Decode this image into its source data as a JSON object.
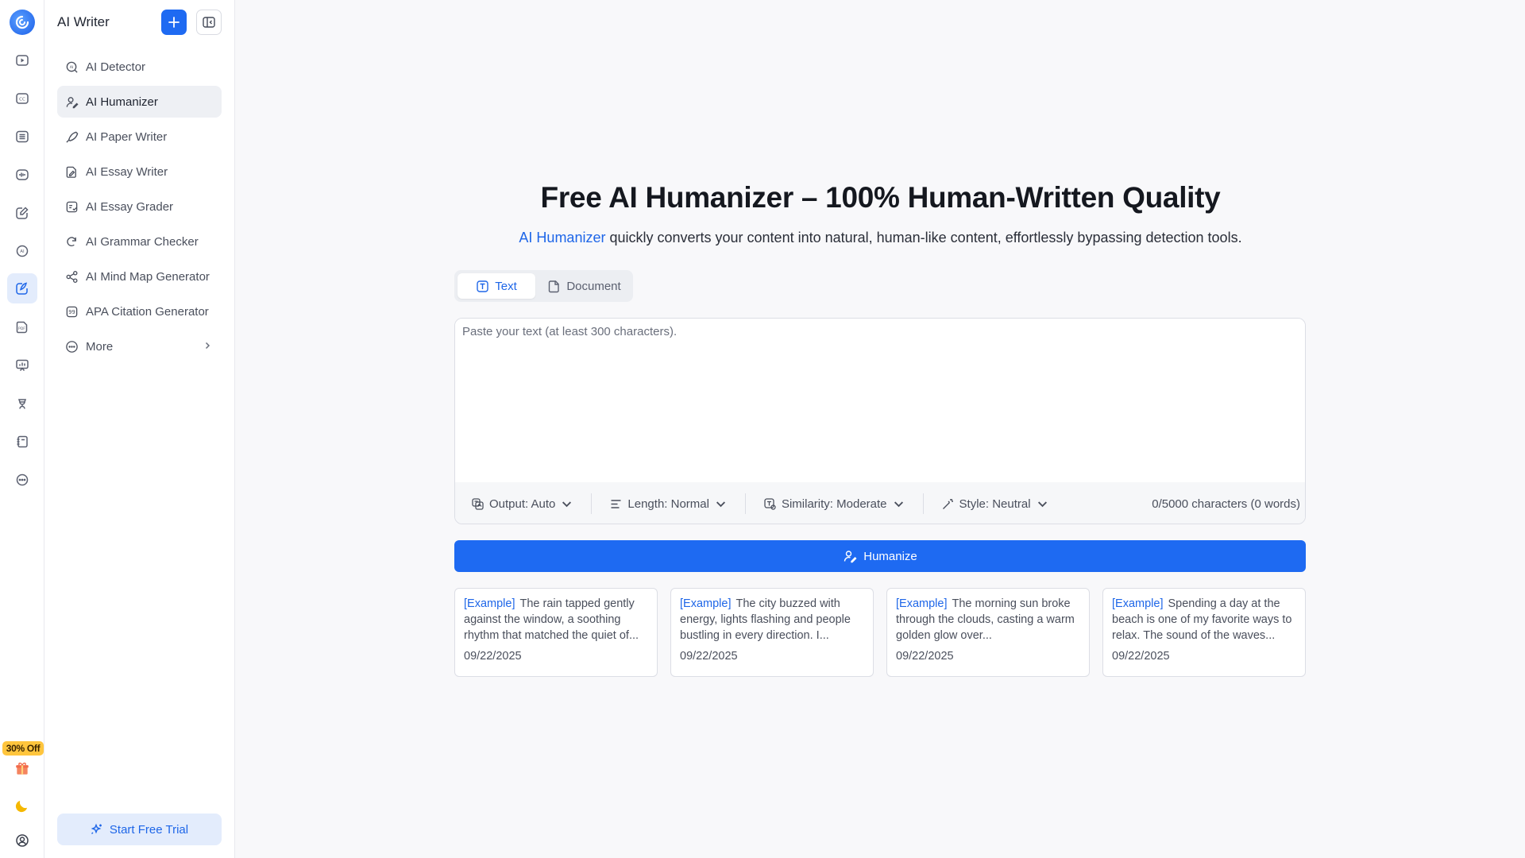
{
  "rail": {
    "promo_badge": "30% Off",
    "items": [
      {
        "name": "video-icon"
      },
      {
        "name": "captions-icon"
      },
      {
        "name": "list-icon"
      },
      {
        "name": "audio-icon"
      },
      {
        "name": "edit-image-icon"
      },
      {
        "name": "ai-detector-icon"
      },
      {
        "name": "ai-writer-icon",
        "active": true
      },
      {
        "name": "pdf-icon"
      },
      {
        "name": "presentation-icon"
      },
      {
        "name": "graduation-icon"
      },
      {
        "name": "notebook-icon"
      },
      {
        "name": "more-icon"
      }
    ]
  },
  "sidebar": {
    "title": "AI Writer",
    "items": [
      {
        "label": "AI Detector",
        "icon": "ai-detector-icon"
      },
      {
        "label": "AI Humanizer",
        "icon": "user-pen-icon",
        "active": true
      },
      {
        "label": "AI Paper Writer",
        "icon": "pen-icon"
      },
      {
        "label": "AI Essay Writer",
        "icon": "essay-icon"
      },
      {
        "label": "AI Essay Grader",
        "icon": "grader-icon"
      },
      {
        "label": "AI Grammar Checker",
        "icon": "grammar-icon"
      },
      {
        "label": "AI Mind Map Generator",
        "icon": "mind-map-icon"
      },
      {
        "label": "APA Citation Generator",
        "icon": "citation-icon"
      },
      {
        "label": "More",
        "icon": "more-dots-icon"
      }
    ],
    "trial_label": "Start Free Trial"
  },
  "main": {
    "headline": "Free AI Humanizer – 100% Human-Written Quality",
    "subhead_link": "AI Humanizer",
    "subhead_rest": " quickly converts your content into natural, human-like content, effortlessly bypassing detection tools.",
    "tabs": [
      {
        "label": "Text",
        "active": true
      },
      {
        "label": "Document"
      }
    ],
    "editor": {
      "placeholder": "Paste your text (at least 300 characters).",
      "value": ""
    },
    "options": {
      "output": "Output: Auto",
      "length": "Length: Normal",
      "similarity": "Similarity: Moderate",
      "style": "Style: Neutral"
    },
    "counter": "0/5000 characters (0 words)",
    "humanize_label": "Humanize",
    "examples": [
      {
        "tag": "[Example]",
        "text": "The rain tapped gently against the window, a soothing rhythm that matched the quiet of...",
        "date": "09/22/2025"
      },
      {
        "tag": "[Example]",
        "text": "The city buzzed with energy, lights flashing and people bustling in every direction. I...",
        "date": "09/22/2025"
      },
      {
        "tag": "[Example]",
        "text": "The morning sun broke through the clouds, casting a warm golden glow over...",
        "date": "09/22/2025"
      },
      {
        "tag": "[Example]",
        "text": "Spending a day at the beach is one of my favorite ways to relax. The sound of the waves...",
        "date": "09/22/2025"
      }
    ]
  },
  "colors": {
    "accent": "#1e6af2",
    "promo": "#ffc53d"
  }
}
